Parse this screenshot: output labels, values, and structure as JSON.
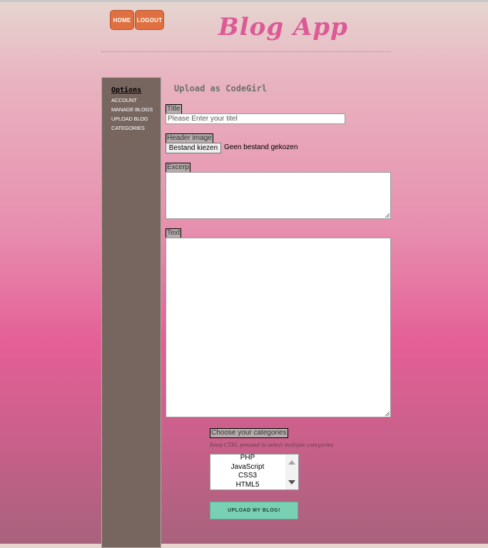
{
  "nav": {
    "home_label": "HOME",
    "logout_label": "LOGOUT"
  },
  "logo_text": "Blog App",
  "sidebar": {
    "title": "Options",
    "items": [
      {
        "label": "ACCOUNT"
      },
      {
        "label": "MANAGE BLOGS"
      },
      {
        "label": "UPLOAD BLOG"
      },
      {
        "label": "CATEGORIES"
      }
    ]
  },
  "form": {
    "heading": "Upload as CodeGirl",
    "title_label": "Title",
    "title_placeholder": "Please Enter your titel",
    "header_image_label": "Header image",
    "file_button_label": "Bestand kiezen",
    "file_status": "Geen bestand gekozen",
    "excerpt_label": "Excerp",
    "text_label": "Text",
    "categories_label": "Choose your categories",
    "categories_hint": "Keep CTRL pressed to select multiple categories",
    "categories_options": [
      "PHP",
      "JavaScript",
      "CSS3",
      "HTML5"
    ],
    "submit_label": "UPLOAD MY BLOG!"
  },
  "colors": {
    "accent_button": "#e0703f",
    "logo": "#dc5a95",
    "sidebar_bg": "#77655f",
    "submit_bg": "#79d0b2"
  }
}
